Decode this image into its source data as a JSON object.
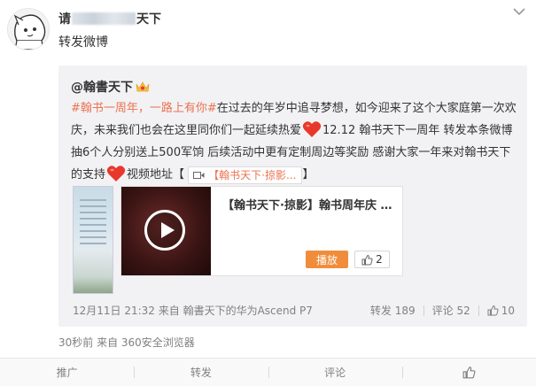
{
  "post": {
    "nickname_start": "请",
    "nickname_end": "天下",
    "text": "转发微博",
    "meta": "30秒前 来自 360安全浏览器"
  },
  "repost": {
    "author": "@翰書天下",
    "topic": "#翰书一周年，一路上有你#",
    "text_part1": "在过去的年岁中追寻梦想，如今迎来了这个大家庭第一次欢庆，未来我们也会在这里同你们一起延续热爱",
    "text_part2": "12.12 翰书天下一周年 转发本条微博抽6个人分别送上500军饷 后续活动中更有定制周边等奖励 感谢大家一年来对翰书天下的支持",
    "text_part3": "视频地址【",
    "video_link_label": "【翰书天下·掠影...",
    "text_part4": "】",
    "time_source": "12月11日 21:32 来自 翰書天下的华为Ascend P7",
    "repost_stat": "转发 189",
    "comment_stat": "评论 52",
    "like_stat": "10"
  },
  "video_card": {
    "title": "【翰书天下·掠影】翰书周年庆 by：...",
    "play_label": "播放",
    "like_count": "2"
  },
  "actions": {
    "promote": "推广",
    "forward": "转发",
    "comment": "评论"
  },
  "colors": {
    "accent_orange": "#eb7350",
    "play_button": "#f08d3c",
    "repost_background": "#f2f2f5",
    "heart": "#e8382c"
  }
}
